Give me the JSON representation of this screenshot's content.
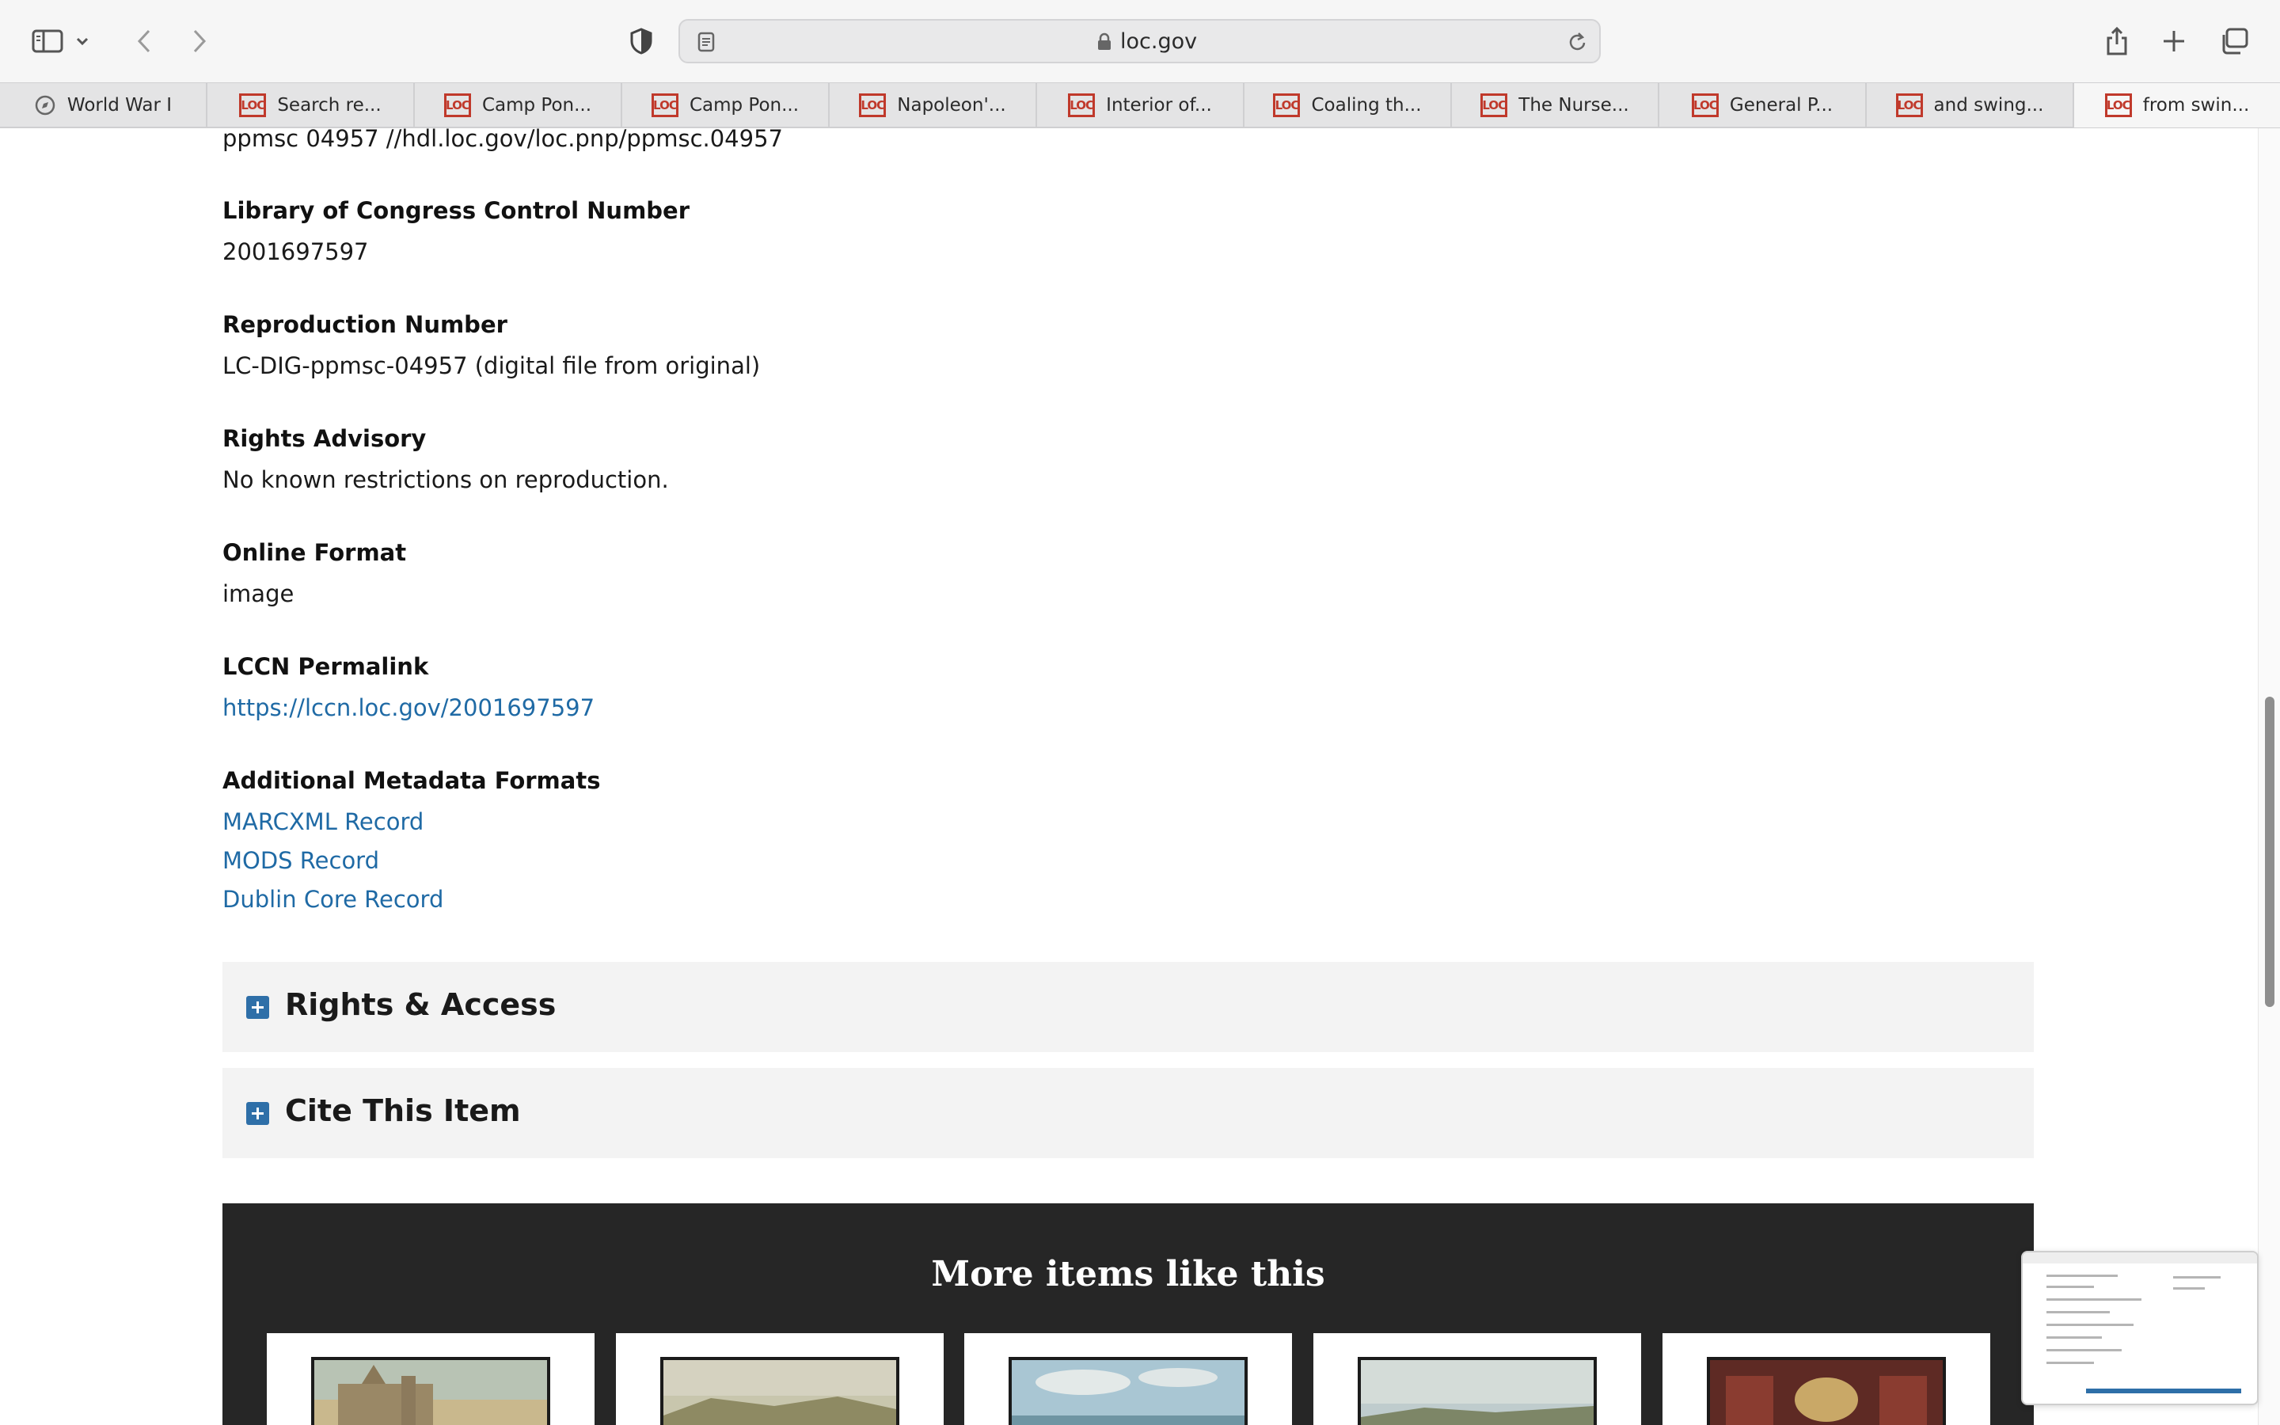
{
  "browser": {
    "url_host": "loc.gov",
    "tabs": [
      {
        "label": "World War I",
        "favicon": "compass-icon",
        "active": false
      },
      {
        "label": "Search re...",
        "favicon": "loc-logo-icon",
        "active": false
      },
      {
        "label": "Camp Pon...",
        "favicon": "loc-logo-icon",
        "active": false
      },
      {
        "label": "Camp Pon...",
        "favicon": "loc-logo-icon",
        "active": false
      },
      {
        "label": "Napoleon'...",
        "favicon": "loc-logo-icon",
        "active": false
      },
      {
        "label": "Interior of...",
        "favicon": "loc-logo-icon",
        "active": false
      },
      {
        "label": "Coaling th...",
        "favicon": "loc-logo-icon",
        "active": false
      },
      {
        "label": "The Nurse...",
        "favicon": "loc-logo-icon",
        "active": false
      },
      {
        "label": "General P...",
        "favicon": "loc-logo-icon",
        "active": false
      },
      {
        "label": "and swing...",
        "favicon": "loc-logo-icon",
        "active": false
      },
      {
        "label": "from swin...",
        "favicon": "loc-logo-icon",
        "active": true
      }
    ],
    "favicon_text": "LOC"
  },
  "page": {
    "call_number_line": "ppmsc 04957 //hdl.loc.gov/loc.pnp/ppmsc.04957",
    "fields": {
      "control_number": {
        "label": "Library of Congress Control Number",
        "value": "2001697597"
      },
      "reproduction_number": {
        "label": "Reproduction Number",
        "value": "LC-DIG-ppmsc-04957 (digital file from original)"
      },
      "rights_advisory": {
        "label": "Rights Advisory",
        "value": "No known restrictions on reproduction."
      },
      "online_format": {
        "label": "Online Format",
        "value": "image"
      },
      "lccn_permalink": {
        "label": "LCCN Permalink",
        "value": "https://lccn.loc.gov/2001697597"
      }
    },
    "additional_metadata": {
      "label": "Additional Metadata Formats",
      "links": [
        "MARCXML Record",
        "MODS Record",
        "Dublin Core Record"
      ]
    },
    "accordions": [
      "Rights & Access",
      "Cite This Item"
    ],
    "more_items_title": "More items like this"
  },
  "colors": {
    "link": "#1f6aa5",
    "accordion_icon": "#2e6fa8",
    "more_band": "#262626",
    "loc_favicon": "#c0392b"
  }
}
